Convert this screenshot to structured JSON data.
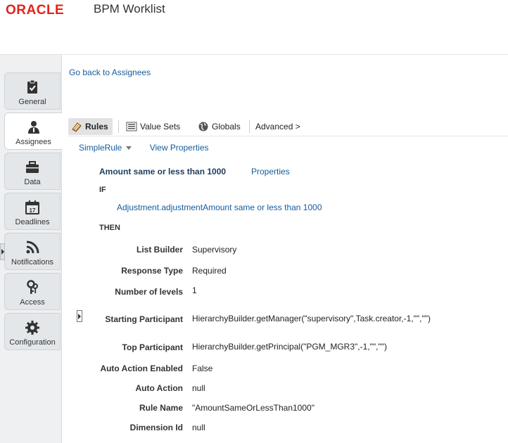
{
  "header": {
    "logo": "ORACLE",
    "app_title": "BPM Worklist"
  },
  "nav": {
    "tabs": [
      {
        "label": "General",
        "icon": "clipboard-check-icon"
      },
      {
        "label": "Assignees",
        "icon": "person-icon"
      },
      {
        "label": "Data",
        "icon": "briefcase-icon"
      },
      {
        "label": "Deadlines",
        "icon": "calendar-icon",
        "calendar_day": "17"
      },
      {
        "label": "Notifications",
        "icon": "rss-icon"
      },
      {
        "label": "Access",
        "icon": "keys-icon"
      },
      {
        "label": "Configuration",
        "icon": "gear-icon"
      }
    ],
    "active": "Assignees"
  },
  "main": {
    "back_link": "Go back to Assignees",
    "toolbar": {
      "rules": "Rules",
      "value_sets": "Value Sets",
      "globals": "Globals",
      "advanced": "Advanced >"
    },
    "subbar": {
      "rule_selector": "SimpleRule",
      "view_properties": "View Properties"
    },
    "rule": {
      "title": "Amount same or less than 1000",
      "properties_link": "Properties",
      "if_label": "IF",
      "condition": "Adjustment.adjustmentAmount  same or less than  1000",
      "then_label": "THEN",
      "props": [
        {
          "label": "List Builder",
          "value": "Supervisory"
        },
        {
          "label": "Response Type",
          "value": "Required"
        },
        {
          "label": "Number of levels",
          "value": "1"
        },
        {
          "label": "Starting Participant",
          "value": "HierarchyBuilder.getManager(\"supervisory\",Task.creator,-1,\"\",\"\")"
        },
        {
          "label": "Top Participant",
          "value": "HierarchyBuilder.getPrincipal(\"PGM_MGR3\",-1,\"\",\"\")"
        },
        {
          "label": "Auto Action Enabled",
          "value": "False"
        },
        {
          "label": "Auto Action",
          "value": "null"
        },
        {
          "label": "Rule Name",
          "value": "\"AmountSameOrLessThan1000\""
        },
        {
          "label": "Dimension Id",
          "value": "null"
        }
      ]
    }
  }
}
